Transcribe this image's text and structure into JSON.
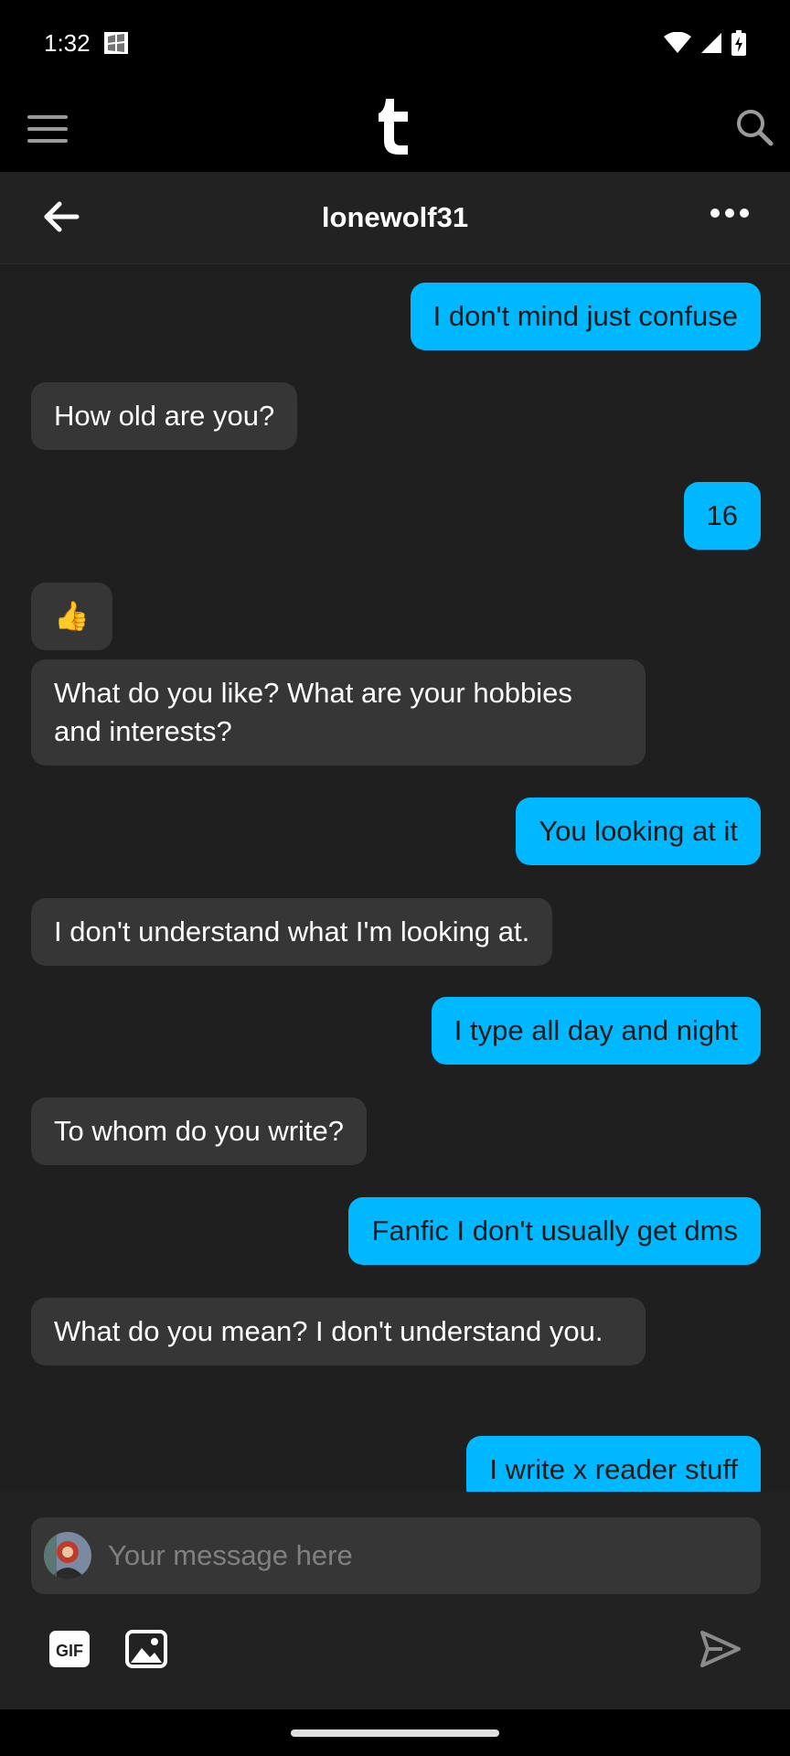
{
  "status": {
    "time": "1:32"
  },
  "header": {
    "title": "lonewolf31"
  },
  "messages": [
    {
      "from": "me",
      "text": "I don't mind just confuse"
    },
    {
      "from": "them",
      "text": "How old are you?"
    },
    {
      "from": "me",
      "text": "16"
    },
    {
      "from": "them",
      "text": "👍"
    },
    {
      "from": "them",
      "text": "What do you like? What are your hobbies and interests?"
    },
    {
      "from": "me",
      "text": "You looking at it"
    },
    {
      "from": "them",
      "text": "I don't understand what I'm looking at."
    },
    {
      "from": "me",
      "text": "I type all day and night"
    },
    {
      "from": "them",
      "text": "To whom do you write?"
    },
    {
      "from": "me",
      "text": "Fanfic I don't usually get dms"
    },
    {
      "from": "them",
      "text": "What do you mean? I don't understand you."
    },
    {
      "from": "me",
      "text": "I write x reader stuff"
    }
  ],
  "composer": {
    "placeholder": "Your message here",
    "gif_label": "GIF"
  },
  "colors": {
    "sent_bubble": "#00b8ff",
    "received_bubble": "#363636",
    "background": "#1f1f1f"
  }
}
